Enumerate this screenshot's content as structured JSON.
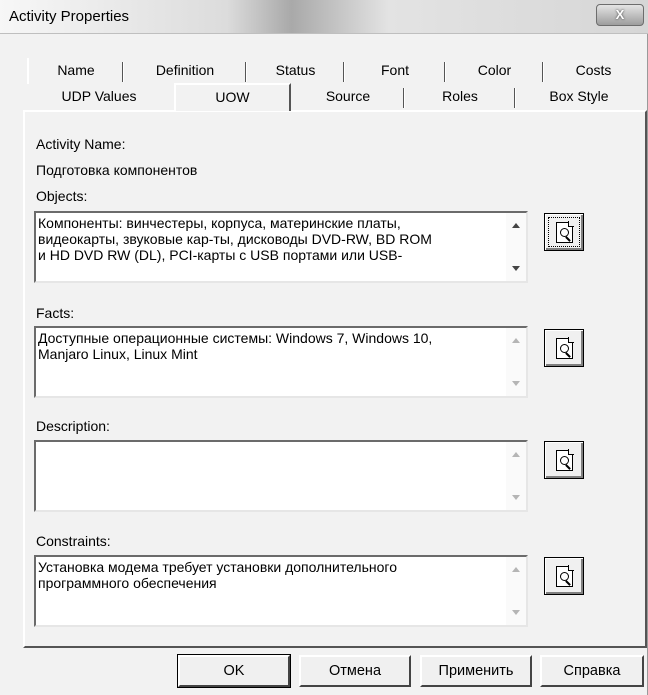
{
  "window": {
    "title": "Activity Properties",
    "close_label": "X"
  },
  "tabs": {
    "row1": [
      "Name",
      "Definition",
      "Status",
      "Font",
      "Color",
      "Costs"
    ],
    "row2": [
      "UDP Values",
      "UOW",
      "Source",
      "Roles",
      "Box Style"
    ],
    "active": "UOW"
  },
  "form": {
    "activity_name_label": "Activity Name:",
    "activity_name_value": "Подготовка компонентов",
    "objects_label": "Objects:",
    "objects_value": "Компоненты: винчестеры, корпуса, материнские платы,\nвидеокарты, звуковые кар-ты, дисководы DVD-RW, BD ROM\nи HD DVD RW (DL), PCI-карты с USB портами или USB-",
    "facts_label": "Facts:",
    "facts_value": "Доступные операционные системы: Windows 7, Windows 10,\nManjaro Linux, Linux Mint",
    "description_label": "Description:",
    "description_value": "",
    "constraints_label": "Constraints:",
    "constraints_value": "Установка модема требует установки дополнительного\nпрограммного обеспечения"
  },
  "buttons": {
    "ok": "OK",
    "cancel": "Отмена",
    "apply": "Применить",
    "help": "Справка"
  },
  "icons": {
    "zoom": "zoom-page-icon",
    "scroll_up": "scroll-up-arrow-icon",
    "scroll_down": "scroll-down-arrow-icon"
  }
}
